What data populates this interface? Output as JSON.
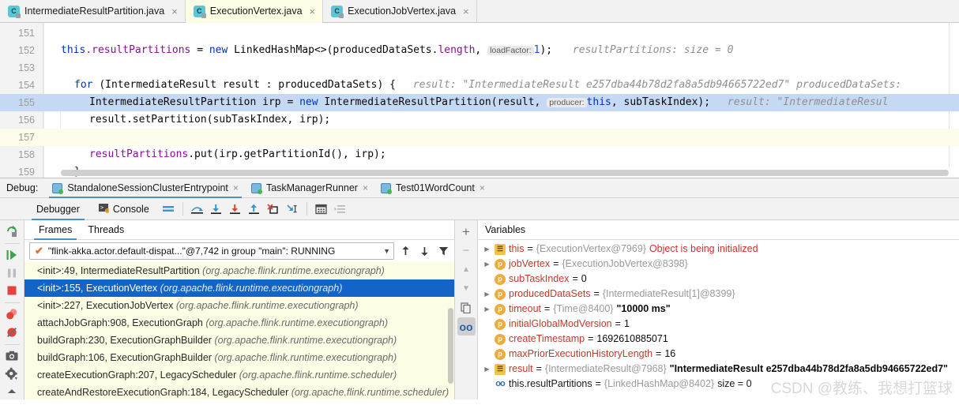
{
  "editor": {
    "tabs": [
      {
        "label": "IntermediateResultPartition.java",
        "active": false,
        "icon": "java-class-icon"
      },
      {
        "label": "ExecutionVertex.java",
        "active": true,
        "icon": "java-class-icon"
      },
      {
        "label": "ExecutionJobVertex.java",
        "active": false,
        "icon": "java-class-icon"
      }
    ],
    "close_glyph": "×",
    "lines": [
      {
        "num": "151",
        "state": "normal"
      },
      {
        "num": "152",
        "state": "normal"
      },
      {
        "num": "153",
        "state": "normal"
      },
      {
        "num": "154",
        "state": "normal"
      },
      {
        "num": "155",
        "state": "highlight"
      },
      {
        "num": "156",
        "state": "normal"
      },
      {
        "num": "157",
        "state": "cream"
      },
      {
        "num": "158",
        "state": "normal"
      },
      {
        "num": "159",
        "state": "normal"
      }
    ],
    "code": {
      "l152_this": "this",
      "l152_dot_field": ".resultPartitions ",
      "l152_eq": "= ",
      "l152_new": "new ",
      "l152_expr": "LinkedHashMap<>(producedDataSets.",
      "l152_length": "length",
      "l152_comma": ", ",
      "l152_param_loadfactor": "loadFactor:",
      "l152_one": "1",
      "l152_tail": ");",
      "l152_hint": "resultPartitions:   size = 0",
      "l154_for": "for ",
      "l154_rest": "(IntermediateResult result : producedDataSets) {",
      "l154_hint": "result: \"IntermediateResult e257dba44b78d2fa8a5db94665722ed7\"    producedDataSets:",
      "l155_head": "IntermediateResultPartition irp = ",
      "l155_new": "new ",
      "l155_call": "IntermediateResultPartition(result, ",
      "l155_param_producer": "producer:",
      "l155_this": "this",
      "l155_tail": ", subTaskIndex);",
      "l155_hint": "result: \"IntermediateResul",
      "l156_obj": "result",
      "l156_rest": ".setPartition(subTaskIndex, irp);",
      "l158_field": "resultPartitions",
      "l158_rest": ".put(irp.getPartitionId(), irp);",
      "l159_brace": "}"
    }
  },
  "debug_header": {
    "label": "Debug:",
    "tabs": [
      {
        "label": "StandaloneSessionClusterEntrypoint",
        "active": true
      },
      {
        "label": "TaskManagerRunner",
        "active": false
      },
      {
        "label": "Test01WordCount",
        "active": false
      }
    ],
    "close_glyph": "×"
  },
  "debugger_toolbar": {
    "tabs": [
      {
        "label": "Debugger",
        "active": true,
        "icon": "debugger-icon"
      },
      {
        "label": "Console",
        "active": false,
        "icon": "console-icon"
      }
    ],
    "buttons": [
      {
        "name": "layout-settings-icon"
      },
      {
        "name": "step-over-icon"
      },
      {
        "name": "step-into-icon"
      },
      {
        "name": "force-step-into-icon"
      },
      {
        "name": "step-out-icon"
      },
      {
        "name": "drop-frame-icon"
      },
      {
        "name": "run-to-cursor-icon"
      },
      {
        "name": "evaluate-expression-icon"
      },
      {
        "name": "show-execution-point-icon"
      }
    ]
  },
  "left_rail": [
    {
      "name": "rerun-icon"
    },
    {
      "name": "resume-program-icon"
    },
    {
      "name": "pause-program-icon"
    },
    {
      "name": "stop-icon"
    },
    {
      "name": "view-breakpoints-icon"
    },
    {
      "name": "mute-breakpoints-icon"
    },
    {
      "name": "screenshot-icon"
    },
    {
      "name": "settings-icon"
    },
    {
      "name": "pin-icon"
    }
  ],
  "frames_panel": {
    "tabs": [
      {
        "label": "Frames",
        "active": true
      },
      {
        "label": "Threads",
        "active": false
      }
    ],
    "thread_selector": {
      "value": "\"flink-akka.actor.default-dispat...\"@7,742 in group \"main\": RUNNING",
      "status_glyph": "✔",
      "caret": "▼"
    },
    "thread_buttons": [
      {
        "name": "move-up-icon",
        "glyph": "↑"
      },
      {
        "name": "move-down-icon",
        "glyph": "↓"
      },
      {
        "name": "filter-icon",
        "glyph": "▼"
      }
    ],
    "frames": [
      {
        "method": "<init>:49, IntermediateResultPartition",
        "pkg": "(org.apache.flink.runtime.executiongraph)",
        "selected": false
      },
      {
        "method": "<init>:155, ExecutionVertex",
        "pkg": "(org.apache.flink.runtime.executiongraph)",
        "selected": true
      },
      {
        "method": "<init>:227, ExecutionJobVertex",
        "pkg": "(org.apache.flink.runtime.executiongraph)",
        "selected": false
      },
      {
        "method": "attachJobGraph:908, ExecutionGraph",
        "pkg": "(org.apache.flink.runtime.executiongraph)",
        "selected": false
      },
      {
        "method": "buildGraph:230, ExecutionGraphBuilder",
        "pkg": "(org.apache.flink.runtime.executiongraph)",
        "selected": false
      },
      {
        "method": "buildGraph:106, ExecutionGraphBuilder",
        "pkg": "(org.apache.flink.runtime.executiongraph)",
        "selected": false
      },
      {
        "method": "createExecutionGraph:207, LegacyScheduler",
        "pkg": "(org.apache.flink.runtime.scheduler)",
        "selected": false
      },
      {
        "method": "createAndRestoreExecutionGraph:184, LegacyScheduler",
        "pkg": "(org.apache.flink.runtime.scheduler)",
        "selected": false
      }
    ]
  },
  "mid_rail": [
    {
      "name": "add-watch-icon",
      "glyph": "+"
    },
    {
      "name": "remove-watch-icon",
      "glyph": "−"
    },
    {
      "name": "move-watch-up-icon",
      "glyph": "▲"
    },
    {
      "name": "move-watch-down-icon",
      "glyph": "▼"
    },
    {
      "name": "copy-value-icon",
      "glyph": "❐"
    },
    {
      "name": "inspect-icon",
      "glyph": "oo"
    }
  ],
  "variables_panel": {
    "title": "Variables",
    "rows": [
      {
        "expandable": true,
        "icon": "object",
        "name": "this",
        "eq": " = ",
        "ref": "{ExecutionVertex@7969}",
        "extra": "Object is being initialized",
        "extra_kind": "error"
      },
      {
        "expandable": true,
        "icon": "p",
        "name": "jobVertex",
        "eq": " = ",
        "ref": "{ExecutionJobVertex@8398}",
        "extra": "",
        "extra_kind": "none"
      },
      {
        "expandable": false,
        "icon": "p",
        "name": "subTaskIndex",
        "eq": " = ",
        "ref": "",
        "extra": "0",
        "extra_kind": "num"
      },
      {
        "expandable": true,
        "icon": "p",
        "name": "producedDataSets",
        "eq": " = ",
        "ref": "{IntermediateResult[1]@8399}",
        "extra": "",
        "extra_kind": "none"
      },
      {
        "expandable": true,
        "icon": "p",
        "name": "timeout",
        "eq": " = ",
        "ref": "{Time@8400}",
        "extra": "\"10000 ms\"",
        "extra_kind": "str"
      },
      {
        "expandable": false,
        "icon": "p",
        "name": "initialGlobalModVersion",
        "eq": " = ",
        "ref": "",
        "extra": "1",
        "extra_kind": "num"
      },
      {
        "expandable": false,
        "icon": "p",
        "name": "createTimestamp",
        "eq": " = ",
        "ref": "",
        "extra": "1692610885071",
        "extra_kind": "num"
      },
      {
        "expandable": false,
        "icon": "p",
        "name": "maxPriorExecutionHistoryLength",
        "eq": " = ",
        "ref": "",
        "extra": "16",
        "extra_kind": "num"
      },
      {
        "expandable": true,
        "icon": "object",
        "name": "result",
        "eq": " = ",
        "ref": "{IntermediateResult@7968}",
        "extra": "\"IntermediateResult e257dba44b78d2fa8a5db94665722ed7\"",
        "extra_kind": "str"
      },
      {
        "expandable": false,
        "icon": "oo",
        "name": "this.resultPartitions",
        "eq": " = ",
        "ref": "{LinkedHashMap@8402}",
        "extra": "size = 0",
        "extra_kind": "size"
      }
    ],
    "watermark": "CSDN @教练、我想打篮球"
  },
  "colors": {
    "accent": "#4a90c4",
    "selection": "#1464c8",
    "code_highlight": "#c5d9f5",
    "frames_bg": "#fdfce4",
    "keyword": "#0033b3",
    "field": "#871094",
    "error": "#d32f2f"
  }
}
